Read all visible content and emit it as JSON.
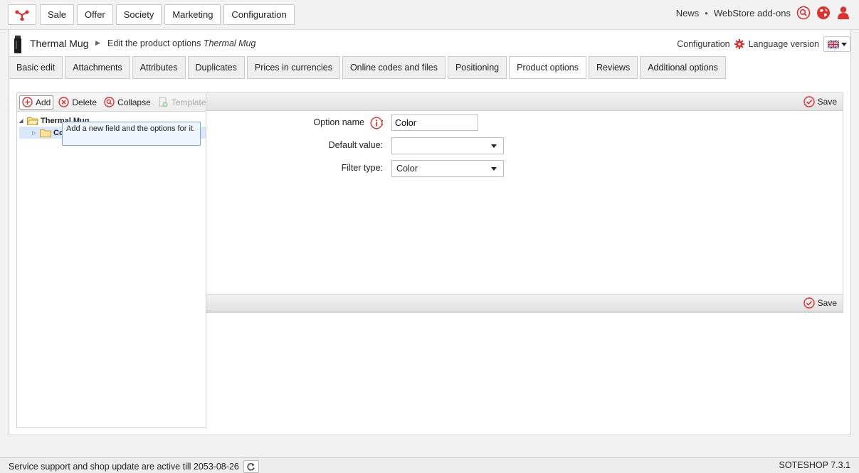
{
  "topnav": {
    "items": [
      "Sale",
      "Offer",
      "Society",
      "Marketing",
      "Configuration"
    ],
    "news": "News",
    "separator": "•",
    "addons": "WebStore add-ons"
  },
  "breadcrumb": {
    "product": "Thermal Mug",
    "page_prefix": "Edit the product options",
    "page_product": "Thermal Mug",
    "configuration": "Configuration",
    "language_version": "Language version"
  },
  "tabs": [
    "Basic edit",
    "Attachments",
    "Attributes",
    "Duplicates",
    "Prices in currencies",
    "Online codes and files",
    "Positioning",
    "Product options",
    "Reviews",
    "Additional options"
  ],
  "active_tab": "Product options",
  "tree_toolbar": {
    "add": "Add",
    "delete": "Delete",
    "collapse": "Collapse",
    "templates": "Templates"
  },
  "tree": {
    "root": "Thermal Mug",
    "child": "Co"
  },
  "tooltip": "Add a new field and the options for it.",
  "form": {
    "save": "Save",
    "option_name_label": "Option name",
    "option_name_colon": ":",
    "option_name_value": "Color",
    "default_value_label": "Default value:",
    "default_value": "",
    "filter_type_label": "Filter type:",
    "filter_type_value": "Color"
  },
  "footer": {
    "support": "Service support and shop update are active till 2053-08-26",
    "version": "SOTESHOP 7.3.1"
  },
  "colors": {
    "accent_red": "#e0302e",
    "selection_blue": "#d9e8fb"
  }
}
